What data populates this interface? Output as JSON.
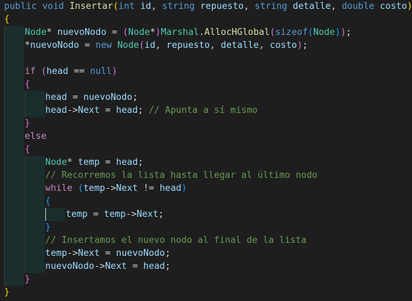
{
  "editor": {
    "theme": {
      "background": "#1e1e1e",
      "keyword": "#569cd6",
      "control": "#c586c0",
      "function": "#dcdcaa",
      "type": "#4ec9b0",
      "variable": "#9cdcfe",
      "comment": "#6a9955",
      "text": "#d4d4d4",
      "bracket_gold": "#ffd700",
      "bracket_orchid": "#da70d6"
    },
    "code": {
      "l1": {
        "kw_public": "public",
        "kw_void": "void",
        "fn_name": "Insertar",
        "p_open": "(",
        "kw_int": "int",
        "p_id": "id",
        "comma1": ",",
        "kw_string1": "string",
        "p_repuesto": "repuesto",
        "comma2": ",",
        "kw_string2": "string",
        "p_detalle": "detalle",
        "comma3": ",",
        "kw_double": "double",
        "p_costo": "costo",
        "p_close": ")"
      },
      "l2": {
        "brace": "{"
      },
      "l3": {
        "ty_node": "Node",
        "star": "*",
        "v_nuevo": "nuevoNodo",
        "eq": "=",
        "cast_open": "(",
        "cast_type": "Node",
        "cast_star": "*",
        "cast_close": ")",
        "marshal": "Marshal",
        "dot": ".",
        "fn_alloc": "AllocHGlobal",
        "paren_open": "(",
        "kw_sizeof": "sizeof",
        "sz_open": "(",
        "sz_type": "Node",
        "sz_close": ")",
        "paren_close": ")",
        "semi": ";"
      },
      "l4": {
        "star": "*",
        "v_nuevo": "nuevoNodo",
        "eq": "=",
        "kw_new": "new",
        "ty_node": "Node",
        "args_open": "(",
        "a_id": "id",
        "c1": ",",
        "a_repuesto": "repuesto",
        "c2": ",",
        "a_detalle": "detalle",
        "c3": ",",
        "a_costo": "costo",
        "args_close": ")",
        "semi": ";"
      },
      "l6": {
        "kw_if": "if",
        "open": "(",
        "v_head": "head",
        "op": "==",
        "kw_null": "null",
        "close": ")"
      },
      "l7": {
        "brace": "{"
      },
      "l8": {
        "v_head": "head",
        "eq": "=",
        "v_nuevo": "nuevoNodo",
        "semi": ";"
      },
      "l9": {
        "v_head": "head",
        "arrow": "->",
        "v_next": "Next",
        "eq": "=",
        "v_head2": "head",
        "semi": ";",
        "comment": "// Apunta a sí mismo"
      },
      "l10": {
        "brace": "}"
      },
      "l11": {
        "kw_else": "else"
      },
      "l12": {
        "brace": "{"
      },
      "l13": {
        "ty_node": "Node",
        "star": "*",
        "v_temp": "temp",
        "eq": "=",
        "v_head": "head",
        "semi": ";"
      },
      "l14": {
        "comment": "// Recorremos la lista hasta llegar al último nodo"
      },
      "l15": {
        "kw_while": "while",
        "open": "(",
        "v_temp": "temp",
        "arrow": "->",
        "v_next": "Next",
        "op": "!=",
        "v_head": "head",
        "close": ")"
      },
      "l16": {
        "brace": "{"
      },
      "l17": {
        "v_temp": "temp",
        "eq": "=",
        "v_temp2": "temp",
        "arrow": "->",
        "v_next": "Next",
        "semi": ";"
      },
      "l18": {
        "brace": "}"
      },
      "l19": {
        "comment": "// Insertamos el nuevo nodo al final de la lista"
      },
      "l20": {
        "v_temp": "temp",
        "arrow": "->",
        "v_next": "Next",
        "eq": "=",
        "v_nuevo": "nuevoNodo",
        "semi": ";"
      },
      "l21": {
        "v_nuevo": "nuevoNodo",
        "arrow": "->",
        "v_next": "Next",
        "eq": "=",
        "v_head": "head",
        "semi": ";"
      },
      "l22": {
        "brace": "}"
      },
      "l23": {
        "brace": "}"
      }
    }
  }
}
